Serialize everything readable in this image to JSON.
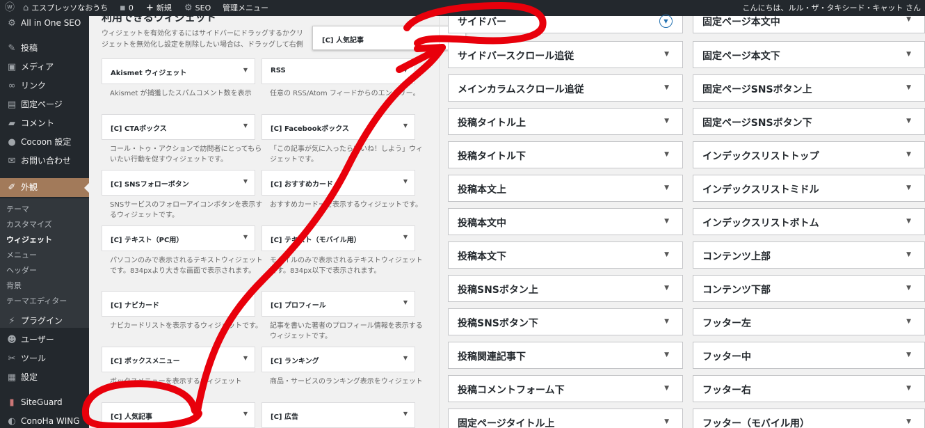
{
  "adminbar": {
    "site_name": "エスプレッソなおうち",
    "comments_count": "0",
    "new_label": "新規",
    "seo_label": "SEO",
    "admin_menu_label": "管理メニュー",
    "greeting": "こんにちは、ルル・ザ・タキシード・キャット さん"
  },
  "sidebar": {
    "items": [
      {
        "label": "All in One SEO",
        "icon": "aioseo-gear-icon"
      },
      {
        "label": "投稿",
        "icon": "pin-icon"
      },
      {
        "label": "メディア",
        "icon": "media-icon"
      },
      {
        "label": "リンク",
        "icon": "link-icon"
      },
      {
        "label": "固定ページ",
        "icon": "page-icon"
      },
      {
        "label": "コメント",
        "icon": "comment-icon"
      },
      {
        "label": "Cocoon 設定",
        "icon": "cocoon-icon"
      },
      {
        "label": "お問い合わせ",
        "icon": "mail-icon"
      },
      {
        "label": "外観",
        "icon": "paintbrush-icon"
      },
      {
        "label": "プラグイン",
        "icon": "plugin-icon"
      },
      {
        "label": "ユーザー",
        "icon": "user-icon"
      },
      {
        "label": "ツール",
        "icon": "wrench-icon"
      },
      {
        "label": "設定",
        "icon": "settings-icon"
      },
      {
        "label": "SiteGuard",
        "icon": "siteguard-icon"
      },
      {
        "label": "ConoHa WING",
        "icon": "conoha-icon"
      }
    ],
    "submenu": [
      "テーマ",
      "カスタマイズ",
      "ウィジェット",
      "メニュー",
      "ヘッダー",
      "背景",
      "テーマエディター"
    ]
  },
  "available": {
    "title": "利用できるウィジェット",
    "desc_line1": "ウィジェットを有効化するにはサイドバーにドラッグするかクリ",
    "desc_line2": "ジェットを無効化し設定を削除したい場合は、ドラッグして右側",
    "widgets": [
      {
        "title": "Akismet ウィジェット",
        "desc": "Akismet が捕獲したスパムコメント数を表示"
      },
      {
        "title": "RSS",
        "desc": "任意の RSS/Atom フィードからのエントリー。"
      },
      {
        "title": "[C] CTAボックス",
        "desc": "コール・トゥ・アクションで訪問者にとってもらいたい行動を促すウィジェットです。"
      },
      {
        "title": "[C] Facebookボックス",
        "desc": "「この記事が気に入ったらいいね！しよう」ウィジェットです。"
      },
      {
        "title": "[C] SNSフォローボタン",
        "desc": "SNSサービスのフォローアイコンボタンを表示するウィジェットです。"
      },
      {
        "title": "[C] おすすめカード",
        "desc": "おすすめカードーを表示するウィジェットです。"
      },
      {
        "title": "[C] テキスト（PC用）",
        "desc": "パソコンのみで表示されるテキストウィジェットです。834pxより大きな画面で表示されます。"
      },
      {
        "title": "[C] テキスト（モバイル用）",
        "desc": "モバイルのみで表示されるテキストウィジェットです。834px以下で表示されます。"
      },
      {
        "title": "[C] ナビカード",
        "desc": "ナビカードリストを表示するウィジェットです。"
      },
      {
        "title": "[C] プロフィール",
        "desc": "記事を書いた著者のプロフィール情報を表示するウィジェットです。"
      },
      {
        "title": "[C] ボックスメニュー",
        "desc": "ボックスメニューを表示するウィジェット"
      },
      {
        "title": "[C] ランキング",
        "desc": "商品・サービスのランキング表示をウィジェット"
      },
      {
        "title": "[C] 人気記事",
        "desc": ""
      },
      {
        "title": "[C] 広告",
        "desc": ""
      }
    ],
    "dragging_title": "[C] 人気記事"
  },
  "areas_left": [
    "サイドバー",
    "サイドバースクロール追従",
    "メインカラムスクロール追従",
    "投稿タイトル上",
    "投稿タイトル下",
    "投稿本文上",
    "投稿本文中",
    "投稿本文下",
    "投稿SNSボタン上",
    "投稿SNSボタン下",
    "投稿関連記事下",
    "投稿コメントフォーム下",
    "固定ページタイトル上"
  ],
  "areas_right": [
    "固定ページ本文中",
    "固定ページ本文下",
    "固定ページSNSボタン上",
    "固定ページSNSボタン下",
    "インデックスリストトップ",
    "インデックスリストミドル",
    "インデックスリストボトム",
    "コンテンツ上部",
    "コンテンツ下部",
    "フッター左",
    "フッター中",
    "フッター右",
    "フッター（モバイル用）"
  ],
  "colors": {
    "admin_dark": "#23282d",
    "active_menu": "#a27a5a",
    "annotation_red": "#e8000b"
  }
}
